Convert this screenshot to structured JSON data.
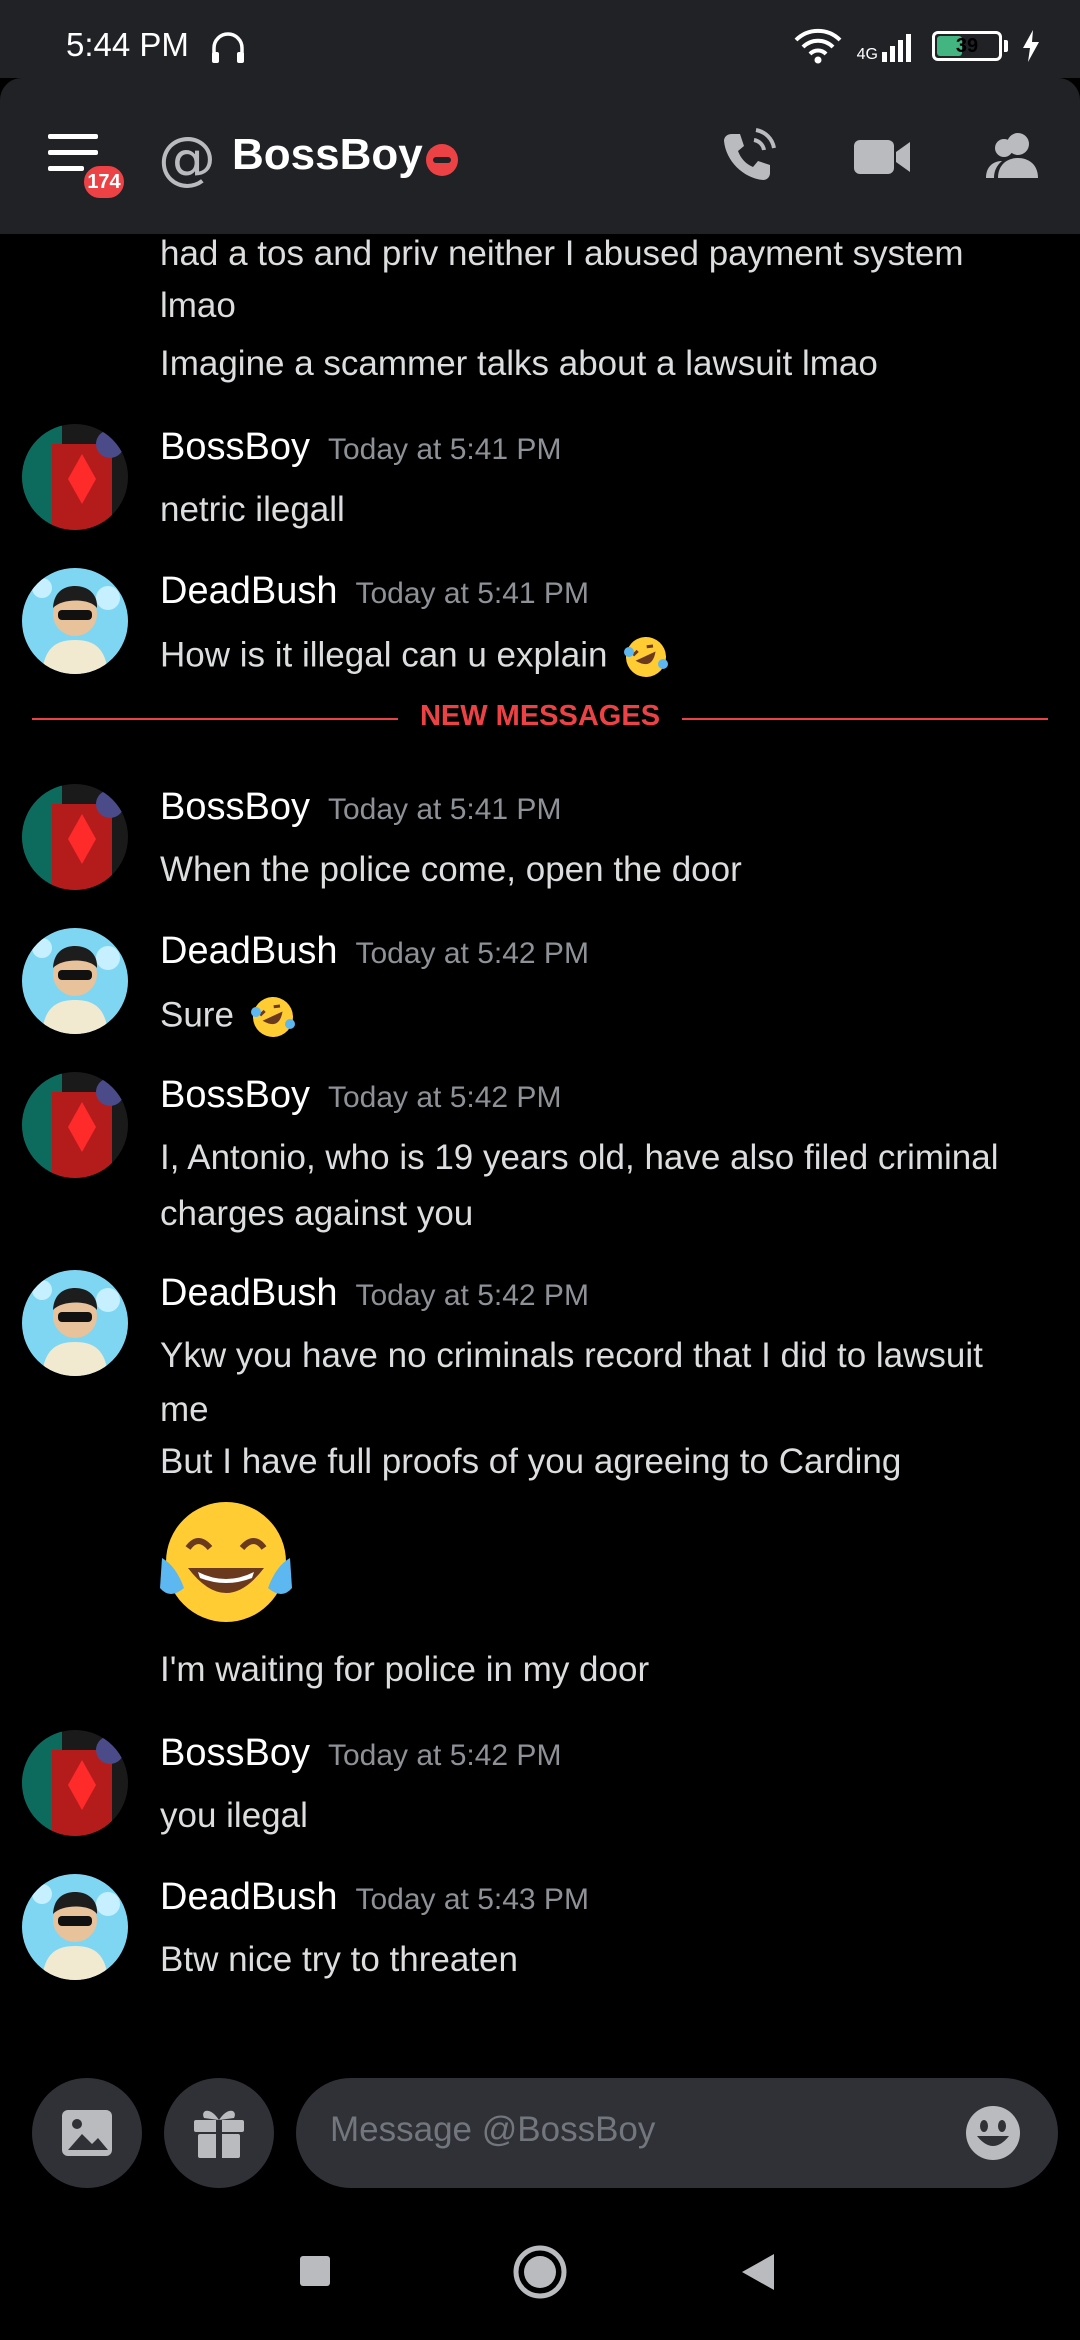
{
  "status_bar": {
    "time": "5:44 PM",
    "network": "4G",
    "battery": "39"
  },
  "header": {
    "unread_badge": "174",
    "title": "BossBoy"
  },
  "messages": {
    "continued": [
      "had a tos and priv neither I abused payment system",
      "lmao",
      "Imagine a scammer talks about a lawsuit lmao"
    ],
    "new_divider": "NEW MESSAGES",
    "groups": [
      {
        "author": "BossBoy",
        "time": "Today at 5:41 PM",
        "lines": [
          "netric ilegall"
        ]
      },
      {
        "author": "DeadBush",
        "time": "Today at 5:41 PM",
        "lines": [
          "How is it illegal can u explain"
        ]
      },
      {
        "author": "BossBoy",
        "time": "Today at 5:41 PM",
        "lines": [
          "When the police come, open the door"
        ]
      },
      {
        "author": "DeadBush",
        "time": "Today at 5:42 PM",
        "lines": [
          "Sure"
        ]
      },
      {
        "author": "BossBoy",
        "time": "Today at 5:42 PM",
        "lines": [
          "I, Antonio, who is 19 years old, have also filed criminal",
          "charges against you"
        ]
      },
      {
        "author": "DeadBush",
        "time": "Today at 5:42 PM",
        "lines": [
          "Ykw you have no criminals record that I did to lawsuit",
          "me",
          "But I have full proofs of you agreeing to Carding",
          "I'm waiting for police in my door"
        ]
      },
      {
        "author": "BossBoy",
        "time": "Today at 5:42 PM",
        "lines": [
          "you ilegal"
        ]
      },
      {
        "author": "DeadBush",
        "time": "Today at 5:43 PM",
        "lines": [
          "Btw nice try to threaten"
        ]
      }
    ]
  },
  "composer": {
    "placeholder": "Message @BossBoy"
  },
  "colors": {
    "accent_red": "#ed4245",
    "header_bg": "#202225",
    "input_bg": "#2f3136"
  }
}
